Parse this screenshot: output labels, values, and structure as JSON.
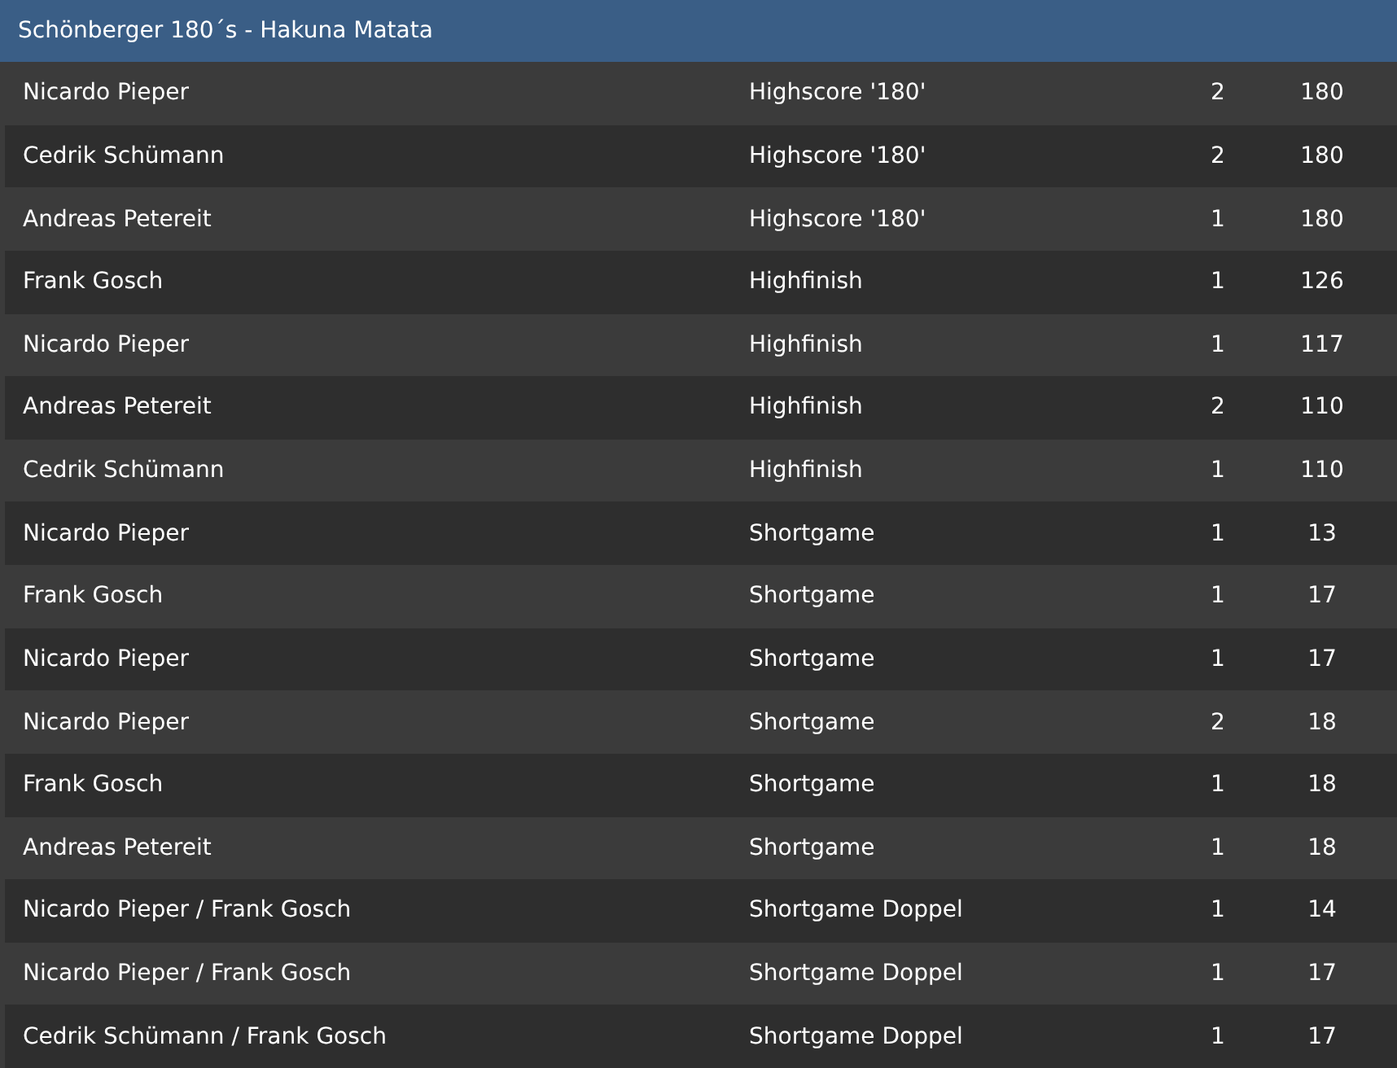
{
  "title": "Schönberger 180´s - Hakuna Matata",
  "rows": [
    {
      "player": "Nicardo Pieper",
      "category": "Highscore '180'",
      "count": "2",
      "value": "180"
    },
    {
      "player": "Cedrik Schümann",
      "category": "Highscore '180'",
      "count": "2",
      "value": "180"
    },
    {
      "player": "Andreas Petereit",
      "category": "Highscore '180'",
      "count": "1",
      "value": "180"
    },
    {
      "player": "Frank Gosch",
      "category": "Highfinish",
      "count": "1",
      "value": "126"
    },
    {
      "player": "Nicardo Pieper",
      "category": "Highfinish",
      "count": "1",
      "value": "117"
    },
    {
      "player": "Andreas Petereit",
      "category": "Highfinish",
      "count": "2",
      "value": "110"
    },
    {
      "player": "Cedrik Schümann",
      "category": "Highfinish",
      "count": "1",
      "value": "110"
    },
    {
      "player": "Nicardo Pieper",
      "category": "Shortgame",
      "count": "1",
      "value": "13"
    },
    {
      "player": "Frank Gosch",
      "category": "Shortgame",
      "count": "1",
      "value": "17"
    },
    {
      "player": "Nicardo Pieper",
      "category": "Shortgame",
      "count": "1",
      "value": "17"
    },
    {
      "player": "Nicardo Pieper",
      "category": "Shortgame",
      "count": "2",
      "value": "18"
    },
    {
      "player": "Frank Gosch",
      "category": "Shortgame",
      "count": "1",
      "value": "18"
    },
    {
      "player": "Andreas Petereit",
      "category": "Shortgame",
      "count": "1",
      "value": "18"
    },
    {
      "player": "Nicardo Pieper / Frank Gosch",
      "category": "Shortgame Doppel",
      "count": "1",
      "value": "14"
    },
    {
      "player": "Nicardo Pieper / Frank Gosch",
      "category": "Shortgame Doppel",
      "count": "1",
      "value": "17"
    },
    {
      "player": "Cedrik Schümann / Frank Gosch",
      "category": "Shortgame Doppel",
      "count": "1",
      "value": "17"
    }
  ]
}
